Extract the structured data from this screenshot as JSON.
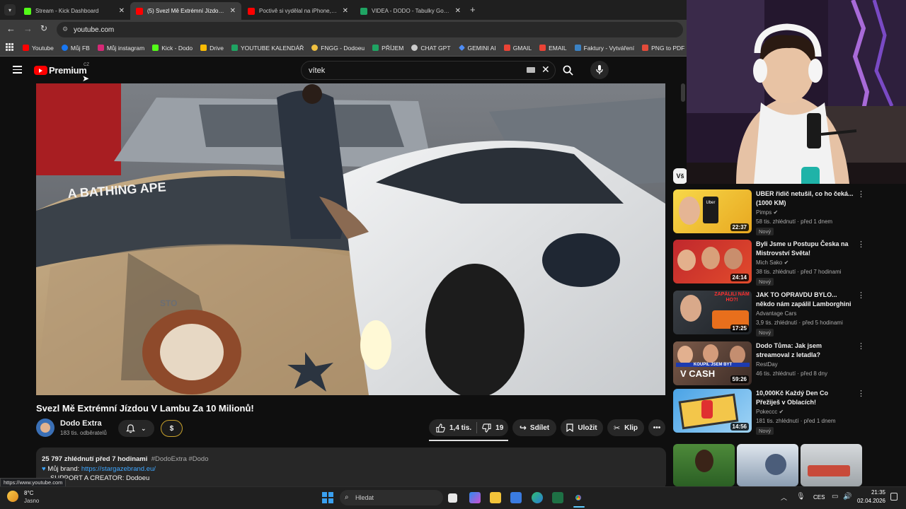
{
  "browser": {
    "tabs": [
      {
        "title": "Stream - Kick Dashboard",
        "color": "#53fc18"
      },
      {
        "title": "(5) Svezl Mě Extrémní Jízdou V",
        "color": "#ff0000"
      },
      {
        "title": "Poctivě si vydělal na iPhone, po",
        "color": "#ff0000"
      },
      {
        "title": "VIDEA - DODO - Tabulky Googl",
        "color": "#1fa463"
      }
    ],
    "active_tab": 1,
    "url": "youtube.com",
    "bookmarks": [
      {
        "label": "Youtube",
        "color": "#ff0000"
      },
      {
        "label": "Můj FB",
        "color": "#1877f2"
      },
      {
        "label": "Můj instagram",
        "color": "#d62976"
      },
      {
        "label": "Kick - Dodo",
        "color": "#53fc18"
      },
      {
        "label": "Drive",
        "color": "#fbbc04"
      },
      {
        "label": "YOUTUBE KALENDÁŘ",
        "color": "#1fa463"
      },
      {
        "label": "FNGG - Dodoeu",
        "color": "#f0c040"
      },
      {
        "label": "PŘÍJEM",
        "color": "#1fa463"
      },
      {
        "label": "CHAT GPT",
        "color": "#cccccc"
      },
      {
        "label": "GEMINI AI",
        "color": "#4f8df5"
      },
      {
        "label": "GMAIL",
        "color": "#ea4335"
      },
      {
        "label": "EMAIL",
        "color": "#ea4335"
      },
      {
        "label": "Faktury - Vytváření",
        "color": "#3b82c4"
      },
      {
        "label": "PNG to PDF",
        "color": "#e34b3a"
      }
    ]
  },
  "youtube": {
    "logo": "Premium",
    "region": "CZ",
    "search_value": "vítek",
    "video_title": "Svezl Mě Extrémní Jízdou V Lambu Za 10 Milionů!",
    "channel": {
      "name": "Dodo Extra",
      "subs": "183 tis. odběratelů"
    },
    "actions": {
      "likes": "1,4 tis.",
      "dislikes": "19",
      "share": "Sdílet",
      "save": "Uložit",
      "clip": "Klip",
      "donate": "$"
    },
    "description": {
      "stats": "25 797 zhlédnutí  před 7 hodinami",
      "tags": "#DodoExtra #Dodo",
      "brand_label": "Můj brand:",
      "brand_link": "https://stargazebrand.eu/",
      "support": "SUPPORT A CREATOR: Dodoeu"
    },
    "chip": "Vš",
    "recommendations": [
      {
        "title": "UBER řidič netušil, co ho čeká... (1000 KM)",
        "channel": "Pimps",
        "meta": "58 tis. zhlédnutí · před 1 dnem",
        "badge": "Nový",
        "duration": "22:37"
      },
      {
        "title": "Byli Jsme u Postupu Česka na Mistrovství Světa!",
        "channel": "Mich Sako",
        "meta": "38 tis. zhlédnutí · před 7 hodinami",
        "badge": "Nový",
        "duration": "24:14"
      },
      {
        "title": "JAK TO OPRAVDU BYLO... někdo nám zapálil Lamborghini 😡 | ...",
        "channel": "Advantage Cars",
        "meta": "3,9 tis. zhlédnutí · před 5 hodinami",
        "badge": "Nový",
        "duration": "17:25"
      },
      {
        "title": "Dodo Tůma: Jak jsem streamoval z letadla?",
        "channel": "RestDay",
        "meta": "46 tis. zhlédnutí · před 8 dny",
        "badge": "",
        "duration": "59:26"
      },
      {
        "title": "10,000Kč Každý Den Co Přežiješ v Oblacích!",
        "channel": "Pokeccc",
        "meta": "181 tis. zhlédnutí · před 1 dnem",
        "badge": "Nový",
        "duration": "14:56"
      }
    ],
    "thumb_texts": {
      "t3": "ZAPÁLILI NÁM HO?!",
      "t4a": "KOUPIL JSEM BYT",
      "t4b": "V CASH",
      "t1": "Uber"
    },
    "video_texts": {
      "bape": "A BATHING APE",
      "sto": "STO"
    }
  },
  "status_url": "https://www.youtube.com",
  "taskbar": {
    "weather_temp": "8°C",
    "weather_desc": "Jasno",
    "search": "Hledat",
    "lang": "CES",
    "time": "21:35",
    "date": "02.04.2026"
  }
}
